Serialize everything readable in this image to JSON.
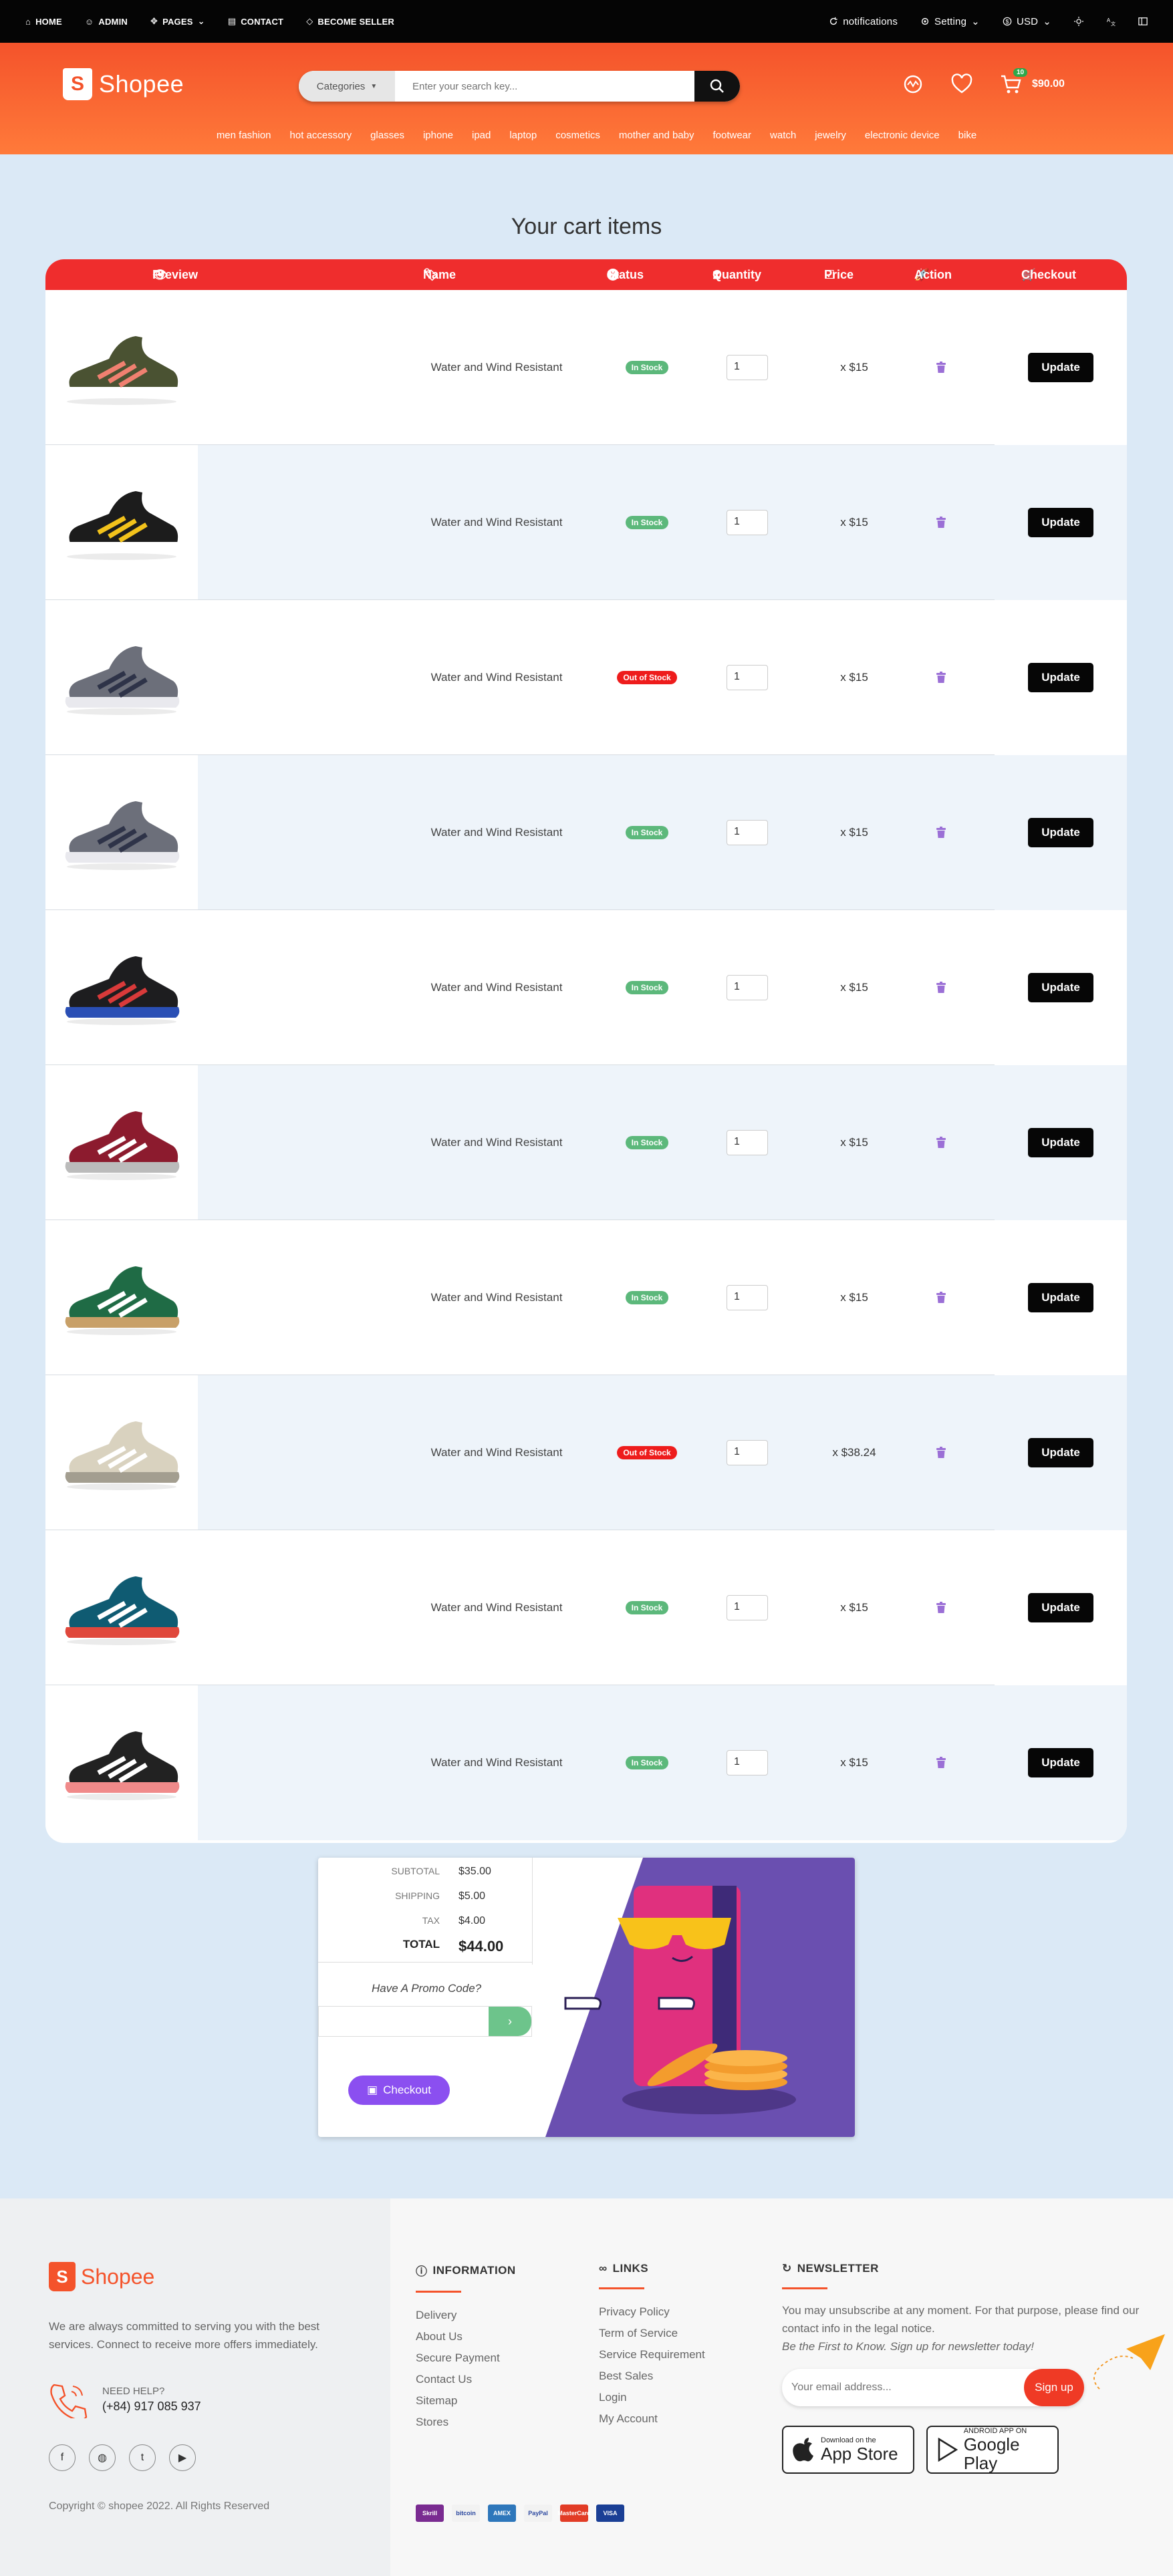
{
  "topbar": {
    "left": [
      {
        "label": "HOME",
        "icon": "home-icon"
      },
      {
        "label": "ADMIN",
        "icon": "user-icon"
      },
      {
        "label": "PAGES",
        "icon": "move-icon"
      },
      {
        "label": "CONTACT",
        "icon": "contact-card-icon"
      },
      {
        "label": "BECOME SELLER",
        "icon": "tag-icon"
      }
    ],
    "notifications": "notifications",
    "setting": "Setting",
    "currency": "USD"
  },
  "header": {
    "logo_letter": "S",
    "logo_text": "Shopee",
    "categories_label": "Categories",
    "search_placeholder": "Enter your search key...",
    "cart_count": "10",
    "cart_total": "$90.00",
    "brand_color": "#f4532b",
    "nav": [
      "men fashion",
      "hot accessory",
      "glasses",
      "iphone",
      "ipad",
      "laptop",
      "cosmetics",
      "mother and baby",
      "footwear",
      "watch",
      "jewelry",
      "electronic device",
      "bike"
    ]
  },
  "cart": {
    "title": "Your cart items",
    "columns": {
      "preview": "Preview",
      "name": "Name",
      "status": "Status",
      "quantity": "Quantity",
      "price": "Price",
      "action": "Action",
      "checkout": "Checkout"
    },
    "update_label": "Update",
    "items": [
      {
        "name": "Water and Wind Resistant",
        "status": "In Stock",
        "in_stock": true,
        "qty": "1",
        "price": "x $15",
        "shoe": "olive"
      },
      {
        "name": "Water and Wind Resistant",
        "status": "In Stock",
        "in_stock": true,
        "qty": "1",
        "price": "x $15",
        "shoe": "black-yellow"
      },
      {
        "name": "Water and Wind Resistant",
        "status": "Out of Stock",
        "in_stock": false,
        "qty": "1",
        "price": "x $15",
        "shoe": "grey-air"
      },
      {
        "name": "Water and Wind Resistant",
        "status": "In Stock",
        "in_stock": true,
        "qty": "1",
        "price": "x $15",
        "shoe": "grey-air"
      },
      {
        "name": "Water and Wind Resistant",
        "status": "In Stock",
        "in_stock": true,
        "qty": "1",
        "price": "x $15",
        "shoe": "black-stripe"
      },
      {
        "name": "Water and Wind Resistant",
        "status": "In Stock",
        "in_stock": true,
        "qty": "1",
        "price": "x $15",
        "shoe": "maroon"
      },
      {
        "name": "Water and Wind Resistant",
        "status": "In Stock",
        "in_stock": true,
        "qty": "1",
        "price": "x $15",
        "shoe": "green"
      },
      {
        "name": "Water and Wind Resistant",
        "status": "Out of Stock",
        "in_stock": false,
        "qty": "1",
        "price": "x $38.24",
        "shoe": "beige"
      },
      {
        "name": "Water and Wind Resistant",
        "status": "In Stock",
        "in_stock": true,
        "qty": "1",
        "price": "x $15",
        "shoe": "teal"
      },
      {
        "name": "Water and Wind Resistant",
        "status": "In Stock",
        "in_stock": true,
        "qty": "1",
        "price": "x $15",
        "shoe": "black-pink"
      }
    ]
  },
  "summary": {
    "subtotal_label": "SUBTOTAL",
    "subtotal": "$35.00",
    "shipping_label": "SHIPPING",
    "shipping": "$5.00",
    "tax_label": "TAX",
    "tax": "$4.00",
    "total_label": "TOTAL",
    "total": "$44.00",
    "promo_label": "Have A Promo Code?",
    "checkout_label": "Checkout"
  },
  "footer": {
    "logo_text": "Shopee",
    "about": "We are always committed to serving you with the best services. Connect to receive more offers immediately.",
    "help_label": "NEED HELP?",
    "phone": "(+84) 917 085 937",
    "copyright": "Copyright © shopee 2022. All Rights Reserved",
    "information": {
      "title": "INFORMATION",
      "links": [
        "Delivery",
        "About Us",
        "Secure Payment",
        "Contact Us",
        "Sitemap",
        "Stores"
      ]
    },
    "links": {
      "title": "LINKS",
      "links": [
        "Privacy Policy",
        "Term of Service",
        "Service Requirement",
        "Best Sales",
        "Login",
        "My Account"
      ]
    },
    "newsletter": {
      "title": "NEWSLETTER",
      "text": "You may unsubscribe at any moment. For that purpose, please find our contact info in the legal notice.",
      "tagline": "Be the First to Know. Sign up for newsletter today!",
      "placeholder": "Your email address...",
      "button": "Sign up"
    },
    "appstore_small": "Download on the",
    "appstore_big": "App Store",
    "googleplay_small": "ANDROID APP ON",
    "googleplay_big": "Google Play",
    "payments": [
      "Skrill",
      "bitcoin",
      "AMEX",
      "PayPal",
      "MasterCard",
      "VISA"
    ]
  }
}
